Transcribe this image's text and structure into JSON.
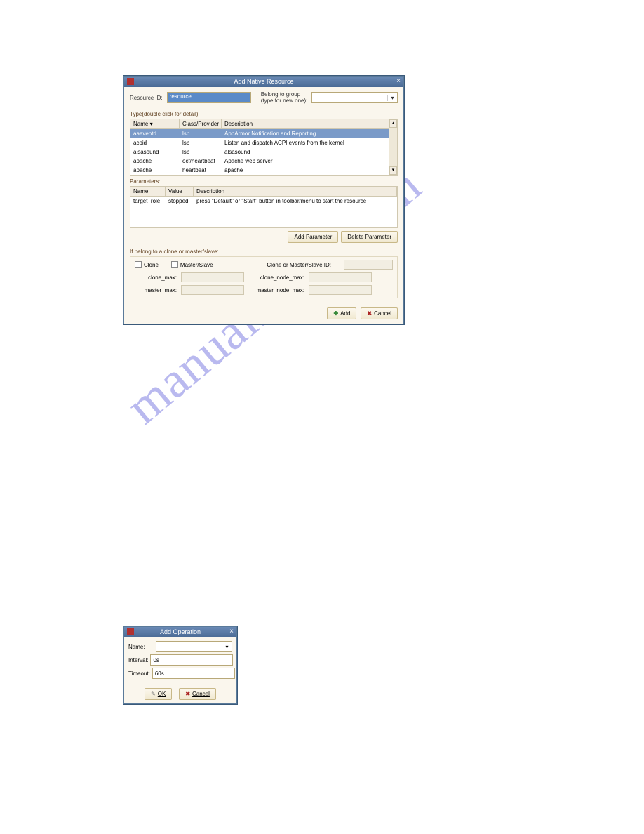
{
  "watermark": "manualshive.com",
  "dialog1": {
    "title": "Add Native Resource",
    "resource_id_label": "Resource ID:",
    "resource_id_value": "resource",
    "belong_to_group_label": "Belong to group\n(type for new one):",
    "type_label": "Type(double click for detail):",
    "columns": {
      "name": "Name",
      "class": "Class/Provider",
      "desc": "Description"
    },
    "rows": [
      {
        "name": "aaeventd",
        "class": "lsb",
        "desc": "AppArmor Notification and Reporting"
      },
      {
        "name": "acpid",
        "class": "lsb",
        "desc": "Listen and dispatch ACPI events from the kernel"
      },
      {
        "name": "alsasound",
        "class": "lsb",
        "desc": "alsasound"
      },
      {
        "name": "apache",
        "class": "ocf/heartbeat",
        "desc": "Apache web server"
      },
      {
        "name": "apache",
        "class": "heartbeat",
        "desc": "apache"
      }
    ],
    "parameters_label": "Parameters:",
    "param_columns": {
      "name": "Name",
      "value": "Value",
      "desc": "Description"
    },
    "param_rows": [
      {
        "name": "target_role",
        "value": "stopped",
        "desc": "press \"Default\" or \"Start\" button in toolbar/menu to start the resource"
      }
    ],
    "add_param_btn": "Add Parameter",
    "delete_param_btn": "Delete Parameter",
    "clone_section_label": "If belong to a clone or master/slave:",
    "clone_cb": "Clone",
    "ms_cb": "Master/Slave",
    "clone_id_label": "Clone or Master/Slave ID:",
    "clone_max_label": "clone_max:",
    "clone_node_max_label": "clone_node_max:",
    "master_max_label": "master_max:",
    "master_node_max_label": "master_node_max:",
    "add_btn": "Add",
    "cancel_btn": "Cancel"
  },
  "dialog2": {
    "title": "Add Operation",
    "name_label": "Name:",
    "interval_label": "Interval:",
    "interval_value": "0s",
    "timeout_label": "Timeout:",
    "timeout_value": "60s",
    "ok_btn": "OK",
    "cancel_btn": "Cancel"
  }
}
